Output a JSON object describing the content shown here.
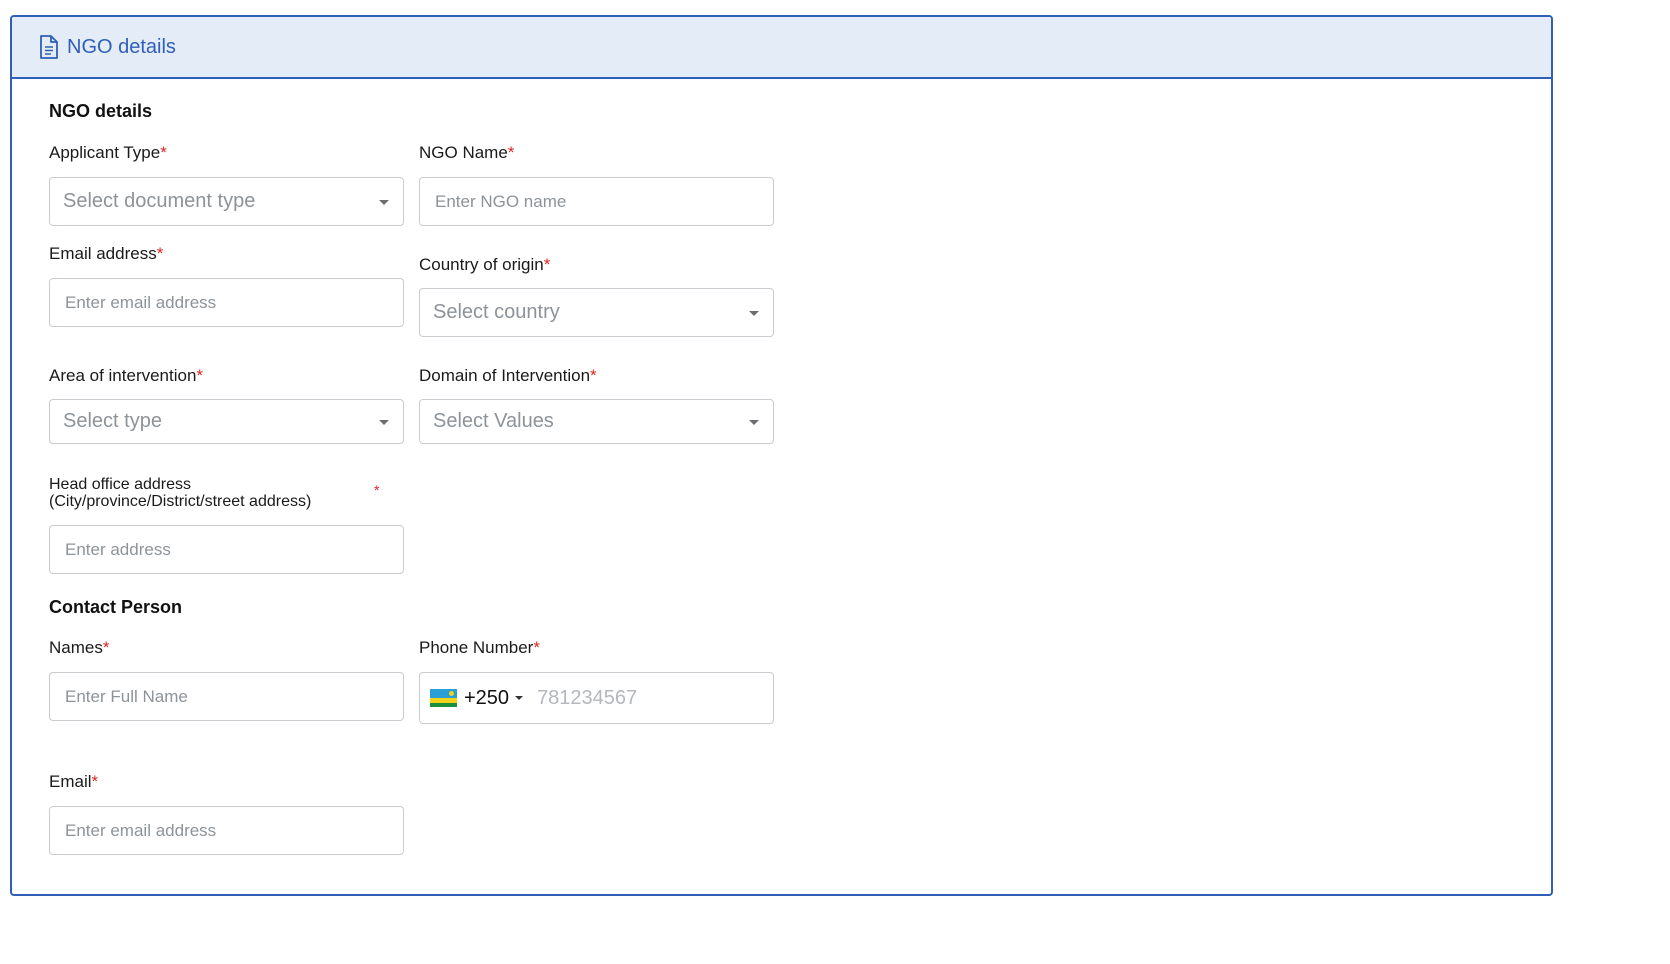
{
  "panel": {
    "title": "NGO details"
  },
  "sections": {
    "ngo": "NGO details",
    "contact": "Contact Person"
  },
  "required_marker": "*",
  "fields": {
    "applicant_type": {
      "label": "Applicant Type",
      "placeholder": "Select document type"
    },
    "ngo_name": {
      "label": "NGO Name",
      "placeholder": "Enter NGO name"
    },
    "email": {
      "label": "Email address",
      "placeholder": "Enter email address"
    },
    "country": {
      "label": "Country of origin",
      "placeholder": "Select country"
    },
    "area": {
      "label": "Area of intervention",
      "placeholder": "Select type"
    },
    "domain": {
      "label": "Domain of Intervention",
      "placeholder": "Select Values"
    },
    "head_office": {
      "label_line1": "Head office address",
      "label_line2": "(City/province/District/street address)",
      "placeholder": "Enter address"
    },
    "names": {
      "label": "Names",
      "placeholder": "Enter Full Name"
    },
    "phone": {
      "label": "Phone Number",
      "dial_code": "+250",
      "placeholder": "781234567"
    },
    "contact_email": {
      "label": "Email",
      "placeholder": "Enter email address"
    }
  },
  "colors": {
    "accent": "#2f5fb8",
    "header_bg": "#e3ecf7",
    "required": "#e02424"
  },
  "icons": {
    "header": "document-icon",
    "flag": "rwanda-flag-icon"
  }
}
